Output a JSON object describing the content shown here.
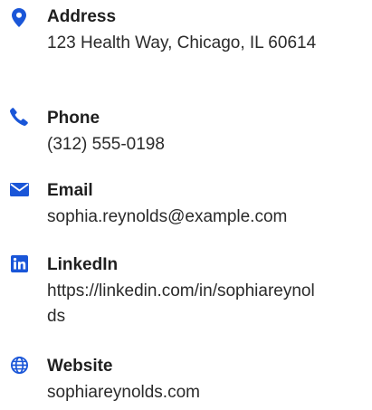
{
  "colors": {
    "icon": "#1a56d8",
    "label": "#1f1f1f",
    "value": "#2a2a2a"
  },
  "contact": {
    "address": {
      "icon": "map-pin-icon",
      "label": "Address",
      "value": "123 Health Way, Chicago, IL 60614"
    },
    "phone": {
      "icon": "phone-icon",
      "label": "Phone",
      "value": "(312) 555-0198"
    },
    "email": {
      "icon": "envelope-icon",
      "label": "Email",
      "value": "sophia.reynolds@example.com"
    },
    "linkedin": {
      "icon": "linkedin-icon",
      "label": "LinkedIn",
      "value": "https://linkedin.com/in/sophiareynolds"
    },
    "website": {
      "icon": "globe-icon",
      "label": "Website",
      "value": "sophiareynolds.com"
    }
  }
}
